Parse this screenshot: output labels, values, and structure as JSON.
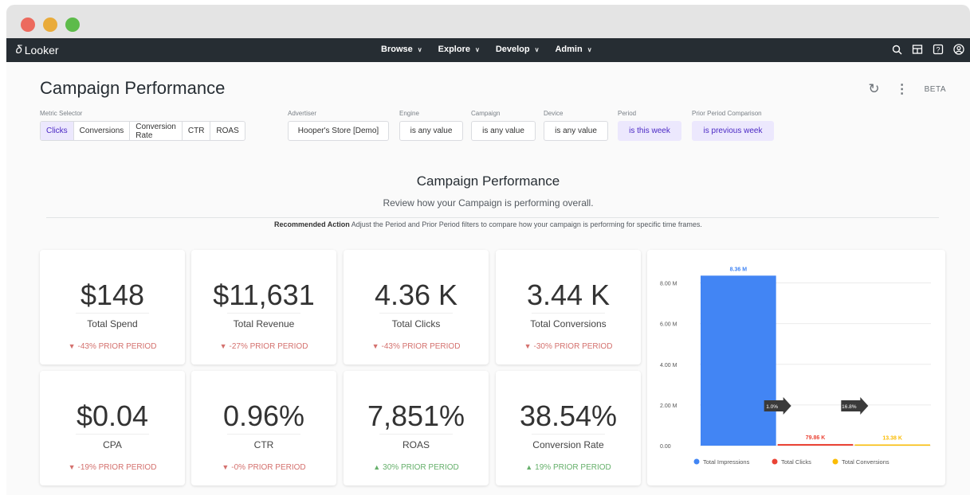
{
  "app": {
    "logo": "Looker"
  },
  "nav": {
    "menu": [
      {
        "label": "Browse"
      },
      {
        "label": "Explore"
      },
      {
        "label": "Develop"
      },
      {
        "label": "Admin"
      }
    ]
  },
  "dashboard": {
    "title": "Campaign Performance",
    "beta": "BETA"
  },
  "filters": {
    "metric_selector": {
      "label": "Metric Selector",
      "options": [
        "Clicks",
        "Conversions",
        "Conversion Rate",
        "CTR",
        "ROAS"
      ],
      "selected": "Clicks"
    },
    "advertiser": {
      "label": "Advertiser",
      "value": "Hooper's Store [Demo]"
    },
    "engine": {
      "label": "Engine",
      "value": "is any value"
    },
    "campaign": {
      "label": "Campaign",
      "value": "is any value"
    },
    "device": {
      "label": "Device",
      "value": "is any value"
    },
    "period": {
      "label": "Period",
      "value": "is this week"
    },
    "prior_period": {
      "label": "Prior Period Comparison",
      "value": "is previous week"
    }
  },
  "section": {
    "title": "Campaign Performance",
    "subtitle": "Review how your Campaign is performing overall.",
    "rec_label": "Recommended Action",
    "rec_text": " Adjust the Period and Prior Period filters to compare how your campaign is performing for specific time frames."
  },
  "kpis": [
    {
      "value": "$148",
      "label": "Total Spend",
      "change": "-43% PRIOR PERIOD",
      "direction": "down"
    },
    {
      "value": "$11,631",
      "label": "Total Revenue",
      "change": "-27% PRIOR PERIOD",
      "direction": "down"
    },
    {
      "value": "4.36 K",
      "label": "Total Clicks",
      "change": "-43% PRIOR PERIOD",
      "direction": "down"
    },
    {
      "value": "3.44 K",
      "label": "Total Conversions",
      "change": "-30% PRIOR PERIOD",
      "direction": "down"
    },
    {
      "value": "$0.04",
      "label": "CPA",
      "change": "-19% PRIOR PERIOD",
      "direction": "down"
    },
    {
      "value": "0.96%",
      "label": "CTR",
      "change": "-0% PRIOR PERIOD",
      "direction": "down"
    },
    {
      "value": "7,851%",
      "label": "ROAS",
      "change": "30% PRIOR PERIOD",
      "direction": "up"
    },
    {
      "value": "38.54%",
      "label": "Conversion Rate",
      "change": "19% PRIOR PERIOD",
      "direction": "up"
    }
  ],
  "colors": {
    "impressions": "#4285f4",
    "clicks": "#ea4335",
    "conversions": "#fbbc04",
    "negative": "#d4716e",
    "positive": "#66b06b"
  },
  "chart_data": {
    "type": "bar",
    "categories": [
      "Total Impressions",
      "Total Clicks",
      "Total Conversions"
    ],
    "values": [
      8360000,
      79860,
      13380
    ],
    "data_labels": [
      "8.36 M",
      "79.86 K",
      "13.38 K"
    ],
    "y_ticks": [
      "0.00",
      "2.00 M",
      "4.00 M",
      "6.00 M",
      "8.00 M"
    ],
    "y_tick_values": [
      0,
      2000000,
      4000000,
      6000000,
      8000000
    ],
    "ylim": [
      0,
      9000000
    ],
    "step_rates": [
      "1.0%",
      "16.8%"
    ],
    "legend": [
      "Total Impressions",
      "Total Clicks",
      "Total Conversions"
    ],
    "legend_position": "bottom",
    "grid": true
  }
}
